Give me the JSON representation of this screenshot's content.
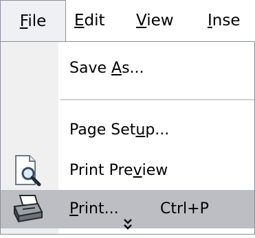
{
  "menubar": {
    "items": [
      {
        "prefix": "",
        "mnemonic": "F",
        "suffix": "ile"
      },
      {
        "prefix": "",
        "mnemonic": "E",
        "suffix": "dit"
      },
      {
        "prefix": "",
        "mnemonic": "V",
        "suffix": "iew"
      },
      {
        "prefix": "",
        "mnemonic": "I",
        "suffix": "nse"
      }
    ]
  },
  "file_menu": {
    "save_as": {
      "prefix": "Save ",
      "mnemonic": "A",
      "suffix": "s..."
    },
    "page_setup": {
      "prefix": "Page Set",
      "mnemonic": "u",
      "suffix": "p..."
    },
    "print_preview": {
      "prefix": "Print Pre",
      "mnemonic": "v",
      "suffix": "iew",
      "icon": "print-preview-icon"
    },
    "print": {
      "prefix": "",
      "mnemonic": "P",
      "suffix": "rint...",
      "shortcut": "Ctrl+P",
      "icon": "printer-icon"
    },
    "expand_icon": "double-chevron-down-icon"
  },
  "colors": {
    "highlight": "#bcbec4",
    "gutter": "#f0f0f0",
    "border": "#8a8f98"
  }
}
